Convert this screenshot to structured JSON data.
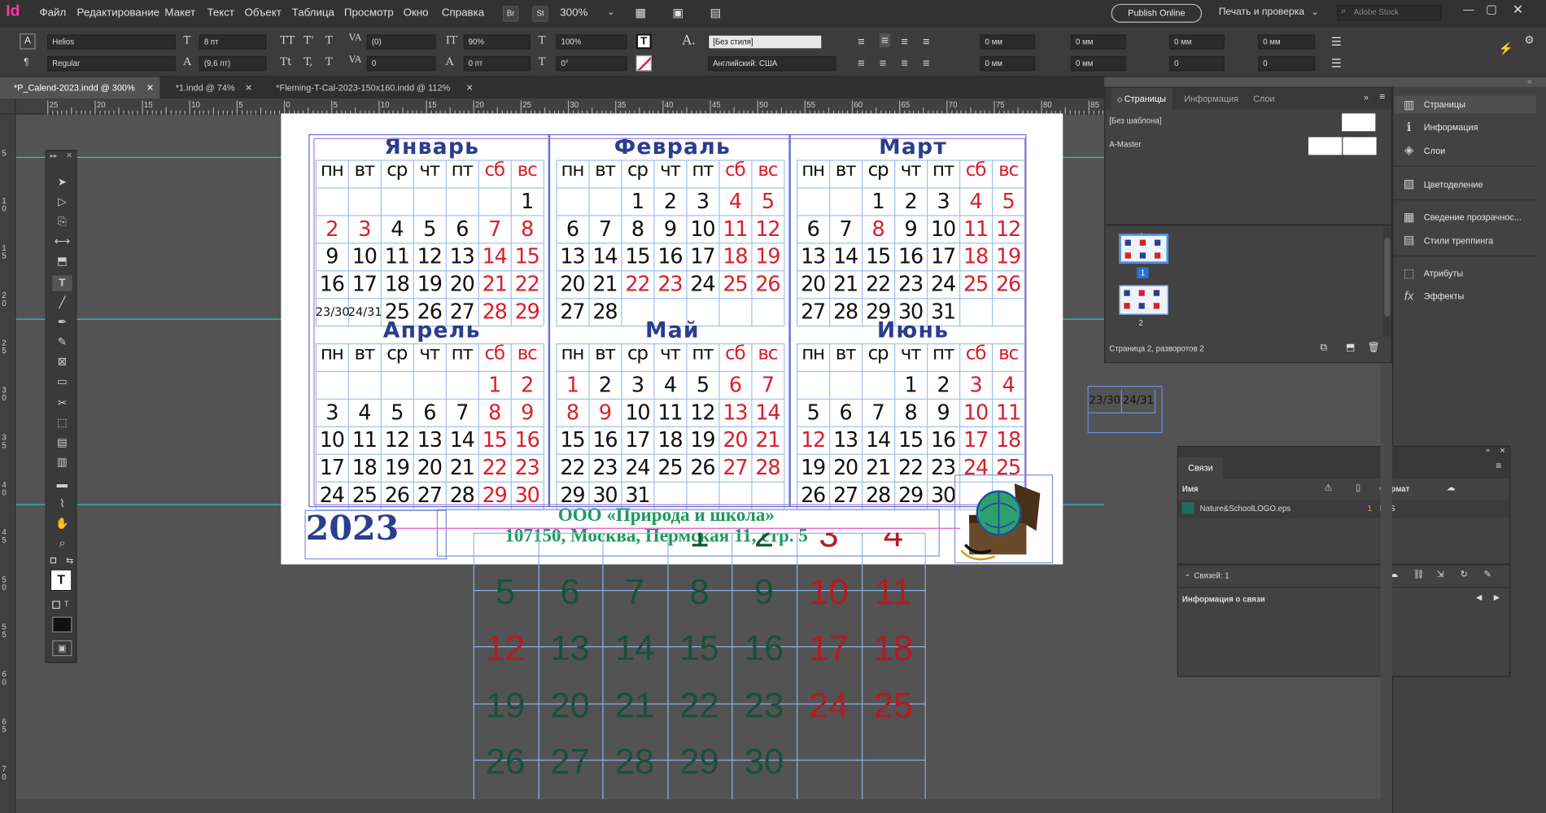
{
  "app": {
    "logo": "Id",
    "zoom": "300%",
    "bridge_label": "Br",
    "stock_label": "St"
  },
  "menu": [
    "Файл",
    "Редактирование",
    "Макет",
    "Текст",
    "Объект",
    "Таблица",
    "Просмотр",
    "Окно",
    "Справка"
  ],
  "header_right": {
    "publish": "Publish Online",
    "print_check": "Печать и проверка",
    "search_placeholder": "Adobe Stock"
  },
  "control": {
    "font": "Helios",
    "style": "Regular",
    "size": "8 пт",
    "leading": "(9,6 пт)",
    "tracking": "(0)",
    "kerning": "0",
    "vscale": "90%",
    "hscale": "100%",
    "baseline": "0 пт",
    "skew": "0°",
    "para_style": "[Без стиля]",
    "language": "Английский: США",
    "indent1": "0 мм",
    "indent2": "0 мм",
    "indent3": "0 мм",
    "indent4": "0 мм",
    "indent5": "0 мм",
    "indent6": "0 мм",
    "indent7": "0",
    "indent8": "0"
  },
  "tabs": [
    "*P_Calend-2023.indd @ 300%",
    "*1.indd @ 74%",
    "*Fleming-T-Cal-2023-150x160.indd @ 112%"
  ],
  "ruler_h": [
    "25",
    "20",
    "15",
    "10",
    "5",
    "0",
    "5",
    "10",
    "15",
    "20",
    "25",
    "30",
    "35",
    "40",
    "45",
    "50",
    "55",
    "60",
    "65",
    "70",
    "75",
    "80",
    "85"
  ],
  "ruler_v": [
    "5",
    "1 0",
    "1 5",
    "2 0",
    "2 5",
    "3 0",
    "3 5",
    "4 0",
    "4 5",
    "5 0",
    "5 5",
    "6 0",
    "6 5",
    "7 0"
  ],
  "weekdays": [
    "пн",
    "вт",
    "ср",
    "чт",
    "пт",
    "сб",
    "вс"
  ],
  "months": [
    {
      "name": "Январь",
      "weeks": [
        [
          "",
          "",
          "",
          "",
          "",
          "",
          "1"
        ],
        [
          "2",
          "3",
          "4",
          "5",
          "6",
          "7",
          "8"
        ],
        [
          "9",
          "10",
          "11",
          "12",
          "13",
          "14",
          "15"
        ],
        [
          "16",
          "17",
          "18",
          "19",
          "20",
          "21",
          "22"
        ],
        [
          "23/30",
          "24/31",
          "25",
          "26",
          "27",
          "28",
          "29"
        ]
      ]
    },
    {
      "name": "Февраль",
      "weeks": [
        [
          "",
          "",
          "1",
          "2",
          "3",
          "4",
          "5"
        ],
        [
          "6",
          "7",
          "8",
          "9",
          "10",
          "11",
          "12"
        ],
        [
          "13",
          "14",
          "15",
          "16",
          "17",
          "18",
          "19"
        ],
        [
          "20",
          "21",
          "22",
          "23",
          "24",
          "25",
          "26"
        ],
        [
          "27",
          "28",
          "",
          "",
          "",
          "",
          ""
        ]
      ]
    },
    {
      "name": "Март",
      "weeks": [
        [
          "",
          "",
          "1",
          "2",
          "3",
          "4",
          "5"
        ],
        [
          "6",
          "7",
          "8",
          "9",
          "10",
          "11",
          "12"
        ],
        [
          "13",
          "14",
          "15",
          "16",
          "17",
          "18",
          "19"
        ],
        [
          "20",
          "21",
          "22",
          "23",
          "24",
          "25",
          "26"
        ],
        [
          "27",
          "28",
          "29",
          "30",
          "31",
          "",
          ""
        ]
      ]
    },
    {
      "name": "Апрель",
      "weeks": [
        [
          "",
          "",
          "",
          "",
          "",
          "1",
          "2"
        ],
        [
          "3",
          "4",
          "5",
          "6",
          "7",
          "8",
          "9"
        ],
        [
          "10",
          "11",
          "12",
          "13",
          "14",
          "15",
          "16"
        ],
        [
          "17",
          "18",
          "19",
          "20",
          "21",
          "22",
          "23"
        ],
        [
          "24",
          "25",
          "26",
          "27",
          "28",
          "29",
          "30"
        ]
      ]
    },
    {
      "name": "Май",
      "weeks": [
        [
          "1",
          "2",
          "3",
          "4",
          "5",
          "6",
          "7"
        ],
        [
          "8",
          "9",
          "10",
          "11",
          "12",
          "13",
          "14"
        ],
        [
          "15",
          "16",
          "17",
          "18",
          "19",
          "20",
          "21"
        ],
        [
          "22",
          "23",
          "24",
          "25",
          "26",
          "27",
          "28"
        ],
        [
          "29",
          "30",
          "31",
          "",
          "",
          "",
          ""
        ]
      ]
    },
    {
      "name": "Июнь",
      "weeks": [
        [
          "",
          "",
          "",
          "1",
          "2",
          "3",
          "4"
        ],
        [
          "5",
          "6",
          "7",
          "8",
          "9",
          "10",
          "11"
        ],
        [
          "12",
          "13",
          "14",
          "15",
          "16",
          "17",
          "18"
        ],
        [
          "19",
          "20",
          "21",
          "22",
          "23",
          "24",
          "25"
        ],
        [
          "26",
          "27",
          "28",
          "29",
          "30",
          "",
          ""
        ]
      ]
    }
  ],
  "red_days": [
    [
      [
        "6",
        "1"
      ],
      [
        "1",
        "0"
      ],
      [
        "1",
        "1"
      ],
      [
        "1",
        "5"
      ],
      [
        "1",
        "6"
      ],
      [
        "2",
        "5"
      ],
      [
        "2",
        "6"
      ],
      [
        "3",
        "5"
      ],
      [
        "3",
        "6"
      ],
      [
        "4",
        "5"
      ],
      [
        "4",
        "6"
      ]
    ],
    [
      [
        "0",
        "5"
      ],
      [
        "0",
        "6"
      ],
      [
        "1",
        "5"
      ],
      [
        "1",
        "6"
      ],
      [
        "2",
        "5"
      ],
      [
        "2",
        "6"
      ],
      [
        "3",
        "2"
      ],
      [
        "3",
        "3"
      ],
      [
        "3",
        "5"
      ],
      [
        "3",
        "6"
      ]
    ],
    [
      [
        "0",
        "5"
      ],
      [
        "0",
        "6"
      ],
      [
        "1",
        "2"
      ],
      [
        "1",
        "5"
      ],
      [
        "1",
        "6"
      ],
      [
        "2",
        "5"
      ],
      [
        "2",
        "6"
      ],
      [
        "3",
        "5"
      ],
      [
        "3",
        "6"
      ]
    ],
    [
      [
        "0",
        "5"
      ],
      [
        "0",
        "6"
      ],
      [
        "1",
        "5"
      ],
      [
        "1",
        "6"
      ],
      [
        "2",
        "5"
      ],
      [
        "2",
        "6"
      ],
      [
        "3",
        "5"
      ],
      [
        "3",
        "6"
      ],
      [
        "4",
        "5"
      ],
      [
        "4",
        "6"
      ]
    ],
    [
      [
        "0",
        "0"
      ],
      [
        "0",
        "5"
      ],
      [
        "0",
        "6"
      ],
      [
        "1",
        "0"
      ],
      [
        "1",
        "1"
      ],
      [
        "1",
        "5"
      ],
      [
        "1",
        "6"
      ],
      [
        "2",
        "5"
      ],
      [
        "2",
        "6"
      ],
      [
        "3",
        "5"
      ],
      [
        "3",
        "6"
      ]
    ],
    [
      [
        "0",
        "5"
      ],
      [
        "0",
        "6"
      ],
      [
        "1",
        "5"
      ],
      [
        "1",
        "6"
      ],
      [
        "2",
        "0"
      ],
      [
        "2",
        "5"
      ],
      [
        "2",
        "6"
      ],
      [
        "3",
        "5"
      ],
      [
        "3",
        "6"
      ]
    ]
  ],
  "footer": {
    "year": "2023",
    "org": "ООО «Природа и школа»",
    "address": "107150, Москва, Пермская 11, стр. 5"
  },
  "overflow_frame": {
    "a": "23/30",
    "b": "24/31"
  },
  "big_table": [
    [
      "",
      "",
      "",
      "1",
      "2",
      "3",
      "4"
    ],
    [
      "5",
      "6",
      "7",
      "8",
      "9",
      "10",
      "11"
    ],
    [
      "12",
      "13",
      "14",
      "15",
      "16",
      "17",
      "18"
    ],
    [
      "19",
      "20",
      "21",
      "22",
      "23",
      "24",
      "25"
    ],
    [
      "26",
      "27",
      "28",
      "29",
      "30",
      "",
      ""
    ]
  ],
  "big_red": [
    [
      "0",
      "5"
    ],
    [
      "0",
      "6"
    ],
    [
      "1",
      "5"
    ],
    [
      "1",
      "6"
    ],
    [
      "2",
      "0"
    ],
    [
      "2",
      "5"
    ],
    [
      "2",
      "6"
    ],
    [
      "3",
      "5"
    ],
    [
      "3",
      "6"
    ]
  ],
  "pages_panel": {
    "tabs": [
      "Страницы",
      "Информация",
      "Слои"
    ],
    "none_master": "[Без шаблона]",
    "a_master": "A-Master",
    "page1": "1",
    "page2": "2",
    "master_tag": "A",
    "status": "Страница 2, разворотов 2"
  },
  "side_buttons": [
    "Страницы",
    "Информация",
    "Слои",
    "Цветоделение",
    "Сведение прозрачнос...",
    "Стили треппинга",
    "Атрибуты",
    "Эффекты"
  ],
  "links_panel": {
    "title": "Связи",
    "col_name": "Имя",
    "col_format": "Формат",
    "file": "Nature&SchoolLOGO.eps",
    "page": "1",
    "format": "EPS",
    "count": "Связей: 1",
    "info": "Информация о связи"
  },
  "colors": {
    "month_blue": "#2a3d8f",
    "weekend_red": "#d8202b",
    "grid_blue": "#9ec1ea",
    "guide_cyan": "#2bc3d0",
    "org_green": "#1b9a5c"
  }
}
